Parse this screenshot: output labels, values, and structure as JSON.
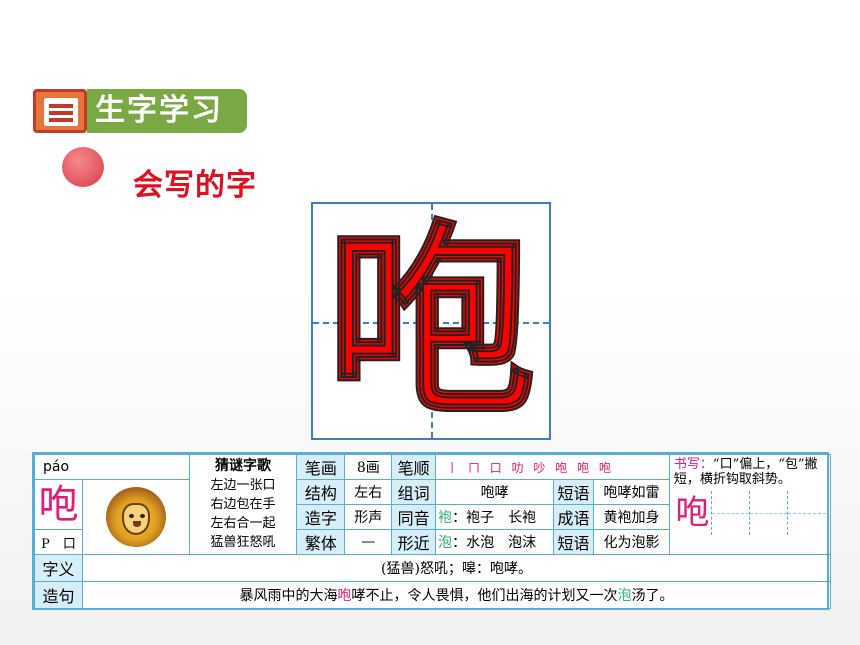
{
  "header": {
    "section_title": "生字学习",
    "subtitle": "会写的字"
  },
  "main_char": "咆",
  "card": {
    "pinyin": "páo",
    "char": "咆",
    "radical_letter": "P",
    "radical": "口",
    "riddle_title": "猜谜字歌",
    "riddle_lines": [
      "左边一张口",
      "右边包在手",
      "左右合一起",
      "猛兽狂怒吼"
    ],
    "labels": {
      "strokes": "笔画",
      "order": "笔顺",
      "structure": "结构",
      "words": "组词",
      "phrase": "短语",
      "formation": "造字",
      "homophone": "同音",
      "idiom": "成语",
      "traditional": "繁体",
      "similar": "形近",
      "phrase2": "短语",
      "meaning": "字义",
      "sentence": "造句"
    },
    "stroke_count": "8画",
    "stroke_order": "丨 ㄇ 口 叻 吵 咆 咆 咆",
    "structure": "左右",
    "word": "咆哮",
    "phrase": "咆哮如雷",
    "formation": "形声",
    "homophone_char": "袍",
    "homophone_rest": "：袍子　长袍",
    "idiom": "黄袍加身",
    "traditional": "—",
    "similar_char": "泡",
    "similar_rest": "：水泡　泡沫",
    "phrase2": "化为泡影",
    "writing_label": "书写：",
    "writing_text": "“口”偏上，“包”撇短，横折钩取斜势。",
    "writing_char": "咆",
    "meaning": "(猛兽)怒吼；嗥：咆哮。",
    "sentence_pre": "暴风雨中的大海",
    "sentence_hl1": "咆",
    "sentence_mid": "哮不止，令人畏惧，他们出海的计划又一次",
    "sentence_hl2": "泡",
    "sentence_post": "汤了。"
  }
}
